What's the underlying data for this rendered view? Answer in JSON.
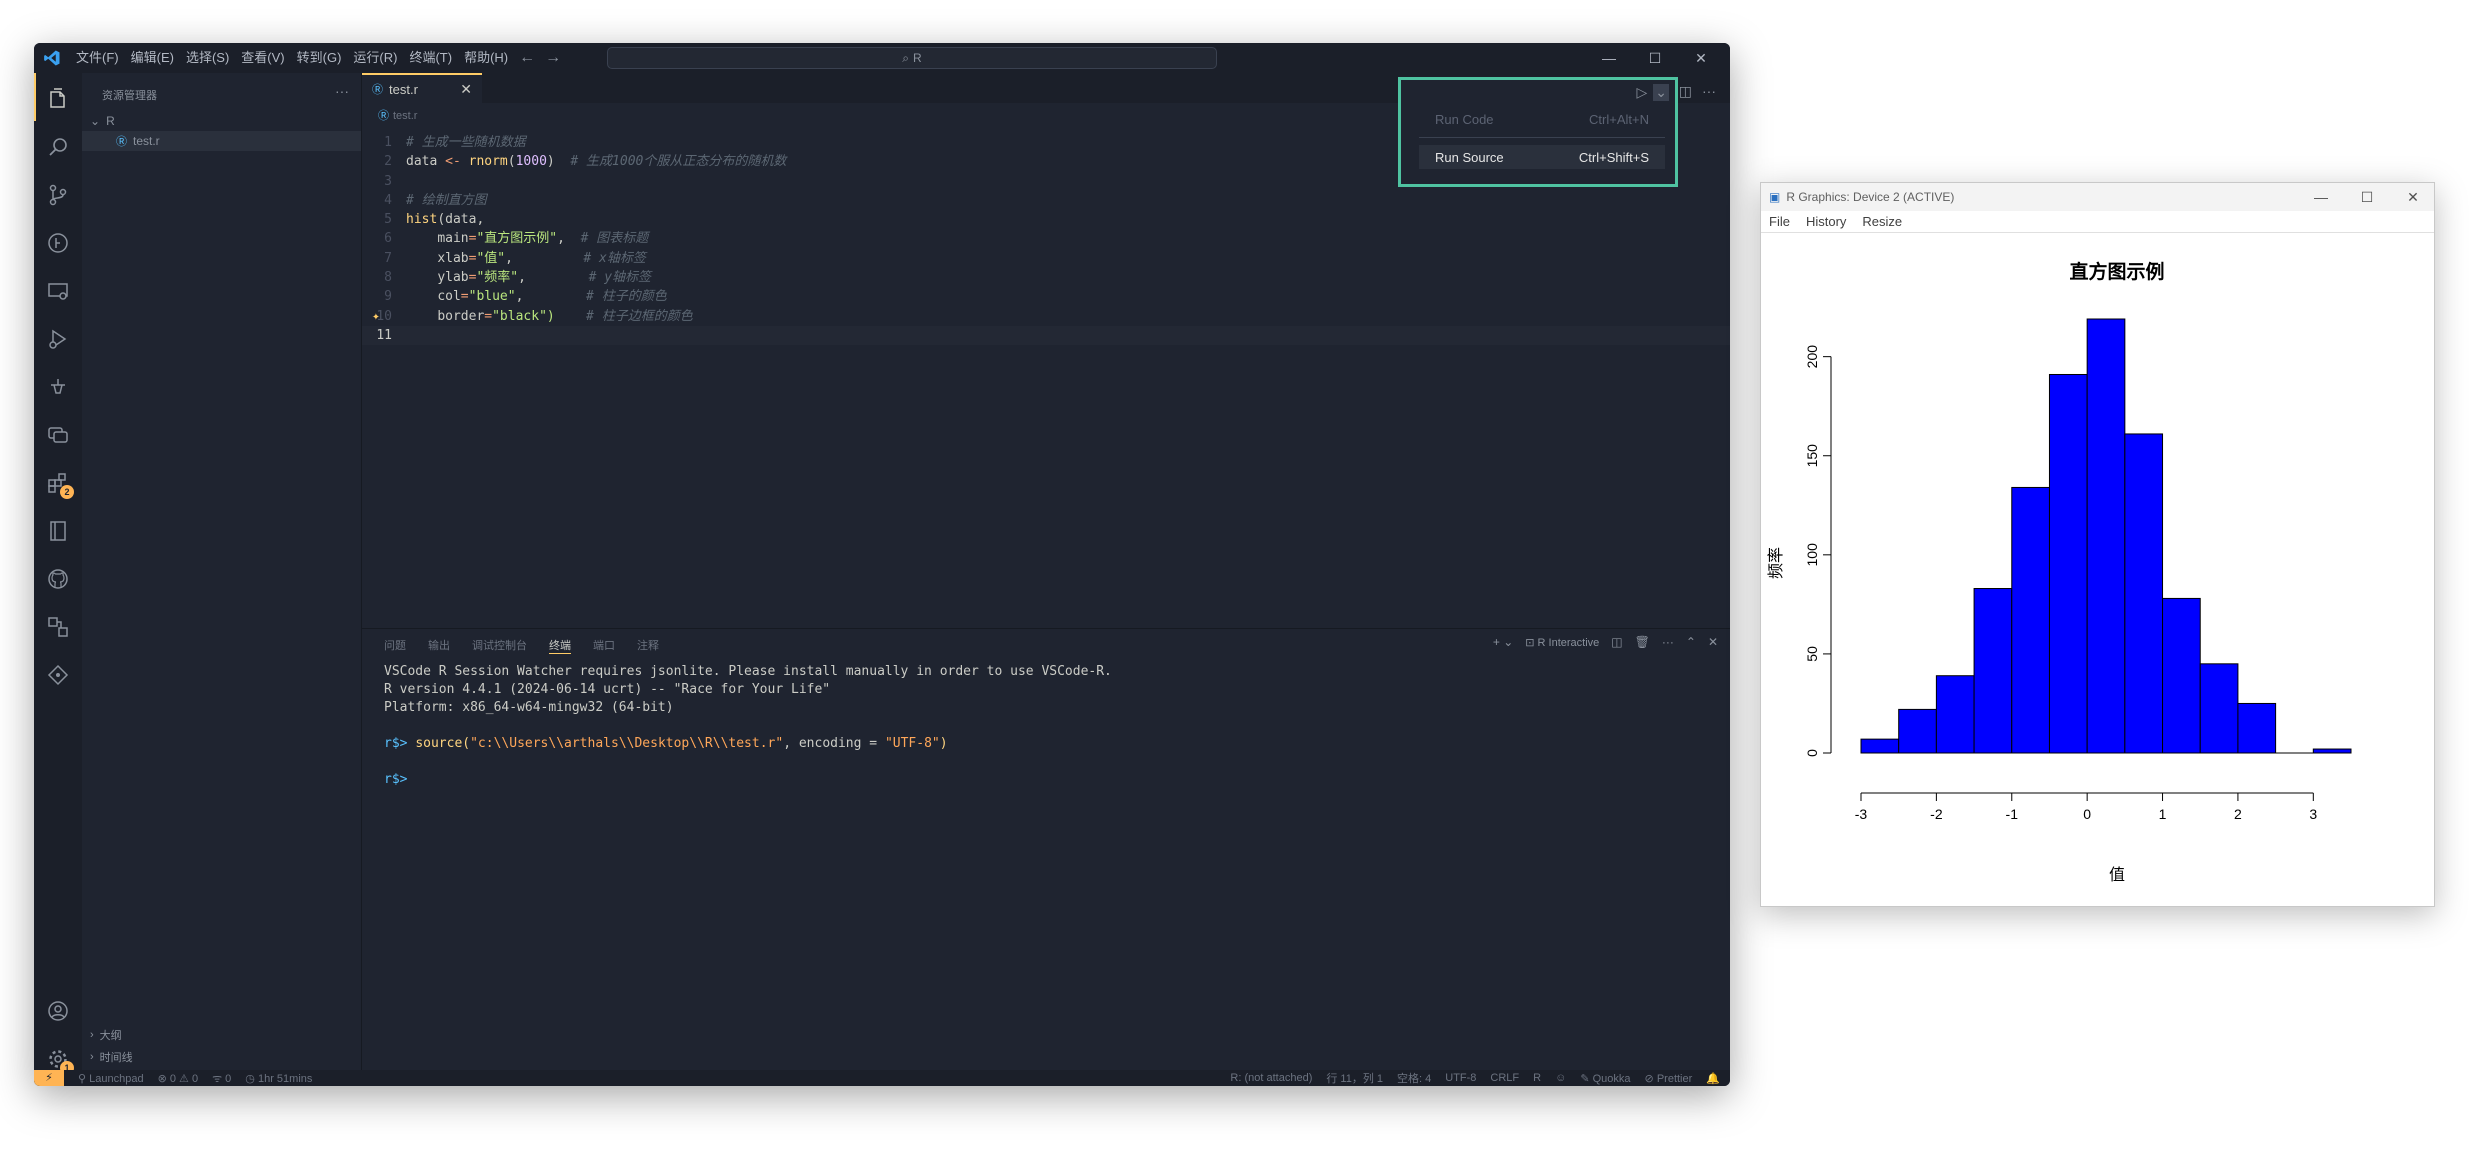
{
  "vscode": {
    "menu": [
      "文件(F)",
      "编辑(E)",
      "选择(S)",
      "查看(V)",
      "转到(G)",
      "运行(R)",
      "终端(T)",
      "帮助(H)"
    ],
    "search_text": "R",
    "activity_badge_extensions": "2",
    "activity_badge_settings": "1",
    "sidebar": {
      "title": "资源管理器",
      "folder": "R",
      "file": "test.r",
      "outline": "大纲",
      "timeline": "时间线"
    },
    "tab": {
      "label": "test.r"
    },
    "breadcrumb": "test.r",
    "code": {
      "l1_comment": "# 生成一些随机数据",
      "l2_var": "data",
      "l2_op": "<-",
      "l2_fn": "rnorm",
      "l2_num": "1000",
      "l2_comment": "# 生成1000个服从正态分布的随机数",
      "l4_comment": "# 绘制直方图",
      "l5_fn": "hist",
      "l5_arg": "data,",
      "l6_key": "main",
      "l6_val": "\"直方图示例\"",
      "l6_comment": "# 图表标题",
      "l7_key": "xlab",
      "l7_val": "\"值\"",
      "l7_comment": "# x轴标签",
      "l8_key": "ylab",
      "l8_val": "\"频率\"",
      "l8_comment": "# y轴标签",
      "l9_key": "col",
      "l9_val": "\"blue\"",
      "l9_comment": "# 柱子的颜色",
      "l10_key": "border",
      "l10_val": "\"black\")",
      "l10_comment": "# 柱子边框的颜色"
    },
    "run_menu": {
      "run_code": "Run Code",
      "run_code_shortcut": "Ctrl+Alt+N",
      "run_source": "Run Source",
      "run_source_shortcut": "Ctrl+Shift+S"
    },
    "panel": {
      "tabs": [
        "问题",
        "输出",
        "调试控制台",
        "终端",
        "端口",
        "注释"
      ],
      "active_tab": "终端",
      "terminal_name": "R Interactive",
      "lines": {
        "l1": "VSCode R Session Watcher requires jsonlite. Please install manually in order to use VSCode-R.",
        "l2": "R version 4.4.1 (2024-06-14 ucrt) -- \"Race for Your Life\"",
        "l3": "Platform: x86_64-w64-mingw32 (64-bit)",
        "prompt": "r$>",
        "cmd_fn": "source(",
        "cmd_str1": "\"c:\\\\Users\\\\arthals\\\\Desktop\\\\R\\\\test.r\"",
        "cmd_mid": ", encoding = ",
        "cmd_str2": "\"UTF-8\"",
        "cmd_end": ")"
      }
    },
    "status": {
      "launchpad": "Launchpad",
      "problems": "⊗ 0 ⚠ 0",
      "ports": "0",
      "time": "1hr 51mins",
      "r_attach": "R: (not attached)",
      "position": "行 11，列 1",
      "spaces": "空格: 4",
      "encoding": "UTF-8",
      "eol": "CRLF",
      "lang": "R",
      "quokka": "Quokka",
      "prettier": "Prettier"
    },
    "colors": {
      "accent": "#ffcc66",
      "highlight_border": "#4fc3a1"
    }
  },
  "rgraphics": {
    "title": "R Graphics: Device 2 (ACTIVE)",
    "menu": [
      "File",
      "History",
      "Resize"
    ]
  },
  "chart_data": {
    "type": "bar",
    "title": "直方图示例",
    "xlabel": "值",
    "ylabel": "频率",
    "bin_edges": [
      -3,
      -2.5,
      -2,
      -1.5,
      -1,
      -0.5,
      0,
      0.5,
      1,
      1.5,
      2,
      2.5,
      3,
      3.5
    ],
    "values": [
      7,
      22,
      39,
      83,
      134,
      191,
      219,
      161,
      78,
      45,
      25,
      0,
      2
    ],
    "xticks": [
      -3,
      -2,
      -1,
      0,
      1,
      2,
      3
    ],
    "yticks": [
      0,
      50,
      100,
      150,
      200
    ],
    "xlim": [
      -3,
      3.5
    ],
    "ylim": [
      0,
      219
    ],
    "bar_color": "#0000ff",
    "border_color": "#000000"
  }
}
